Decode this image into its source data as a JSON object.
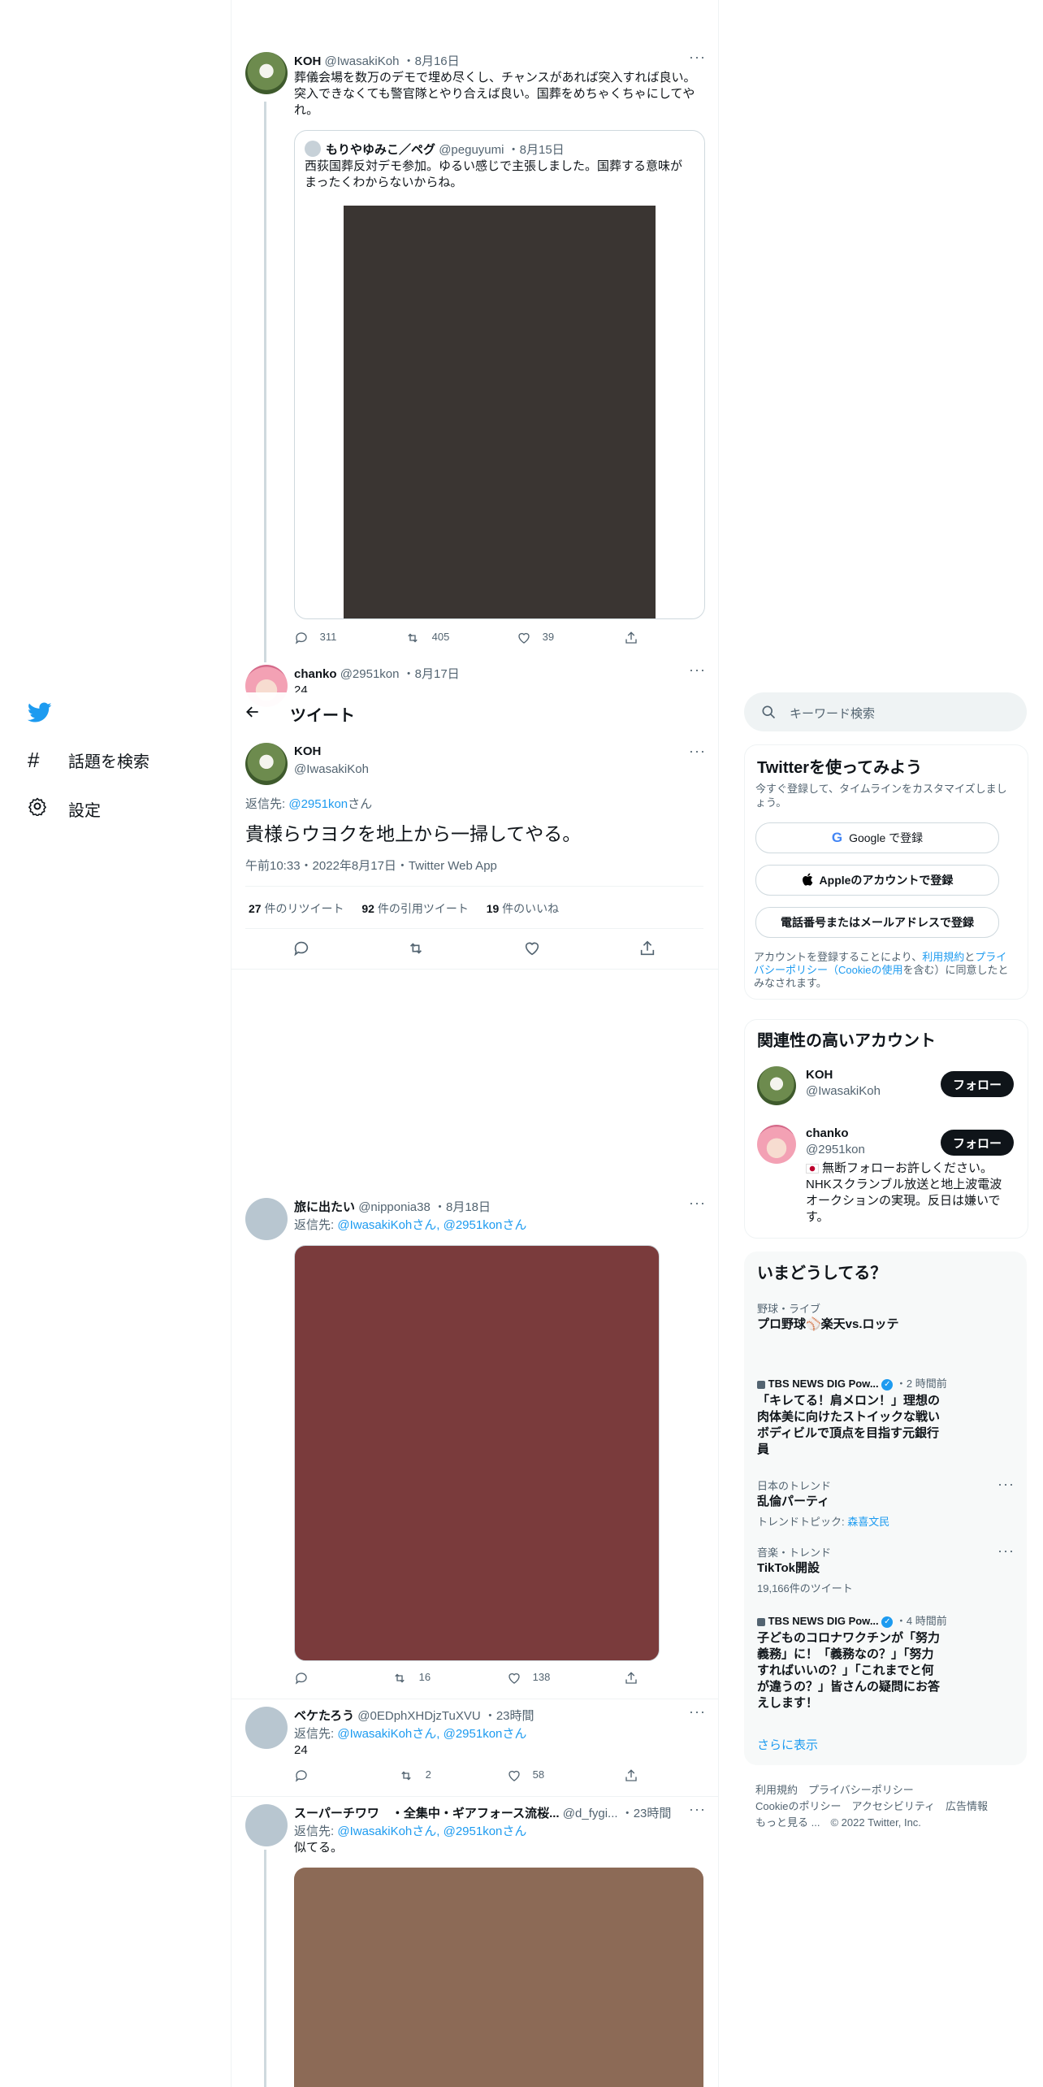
{
  "nav": {
    "explore": "話題を検索",
    "settings": "設定"
  },
  "header": {
    "title": "ツイート"
  },
  "tweet_koh_quote": {
    "name": "KOH",
    "handle": "@IwasakiKoh",
    "date": "・8月16日",
    "text": "葬儀会場を数万のデモで埋め尽くし、チャンスがあれば突入すれば良い。突入できなくても警官隊とやり合えば良い。国葬をめちゃくちゃにしてやれ。",
    "quoted": {
      "name": "もりやゆみこ／ペグ",
      "handle": "@peguyumi",
      "date": "・8月15日",
      "text": "西荻国葬反対デモ参加。ゆるい感じで主張しました。国葬する意味がまったくわからないからね。"
    },
    "replies": "311",
    "retweets": "405",
    "likes": "39"
  },
  "tweet_chanko": {
    "name": "chanko",
    "handle": "@2951kon",
    "date": "・8月17日",
    "text": "24"
  },
  "main_tweet": {
    "name": "KOH",
    "handle": "@IwasakiKoh",
    "reply_prefix": "返信先: ",
    "reply_to": "@2951kon",
    "reply_suffix": "さん",
    "text": "貴様らウヨクを地上から一掃してやる。",
    "meta": "午前10:33・2022年8月17日・Twitter Web App",
    "retweets_count": "27",
    "retweets_label": " 件のリツイート",
    "quotes_count": "92",
    "quotes_label": " 件の引用ツイート",
    "likes_count": "19",
    "likes_label": " 件のいいね"
  },
  "reply1": {
    "name": "旅に出たい",
    "handle": "@nipponia38",
    "date": "・8月18日",
    "reply_prefix": "返信先: ",
    "reply_to": "@IwasakiKohさん, @2951konさん",
    "retweets": "16",
    "likes": "138"
  },
  "reply2": {
    "name": "ベケたろう",
    "handle": "@0EDphXHDjzTuXVU",
    "date": "・23時間",
    "reply_prefix": "返信先: ",
    "reply_to": "@IwasakiKohさん, @2951konさん",
    "text": "24",
    "retweets": "2",
    "likes": "58"
  },
  "reply3": {
    "name": "スーパーチワワ　・全集中・ギアフォース流桜...",
    "handle": "@d_fygi...",
    "date": "・23時間",
    "reply_prefix": "返信先: ",
    "reply_to": "@IwasakiKohさん, @2951konさん",
    "text": "似てる。"
  },
  "search": {
    "placeholder": "キーワード検索"
  },
  "signup": {
    "title": "Twitterを使ってみよう",
    "subtitle": "今すぐ登録して、タイムラインをカスタマイズしましょう。",
    "google": "Google で登録",
    "apple": "Appleのアカウントで登録",
    "phone": "電話番号またはメールアドレスで登録",
    "terms_1": "アカウントを登録することにより、",
    "terms_link1": "利用規約",
    "terms_2": "と",
    "terms_link2": "プライバシーポリシー（Cookieの使用",
    "terms_3": "を含む）に同意したとみなされます。"
  },
  "related": {
    "title": "関連性の高いアカウント",
    "accounts": [
      {
        "name": "KOH",
        "handle": "@IwasakiKoh",
        "button": "フォロー",
        "bio": ""
      },
      {
        "name": "chanko",
        "handle": "@2951kon",
        "button": "フォロー",
        "bio": "無断フォローお許しください。NHKスクランブル放送と地上波電波オークションの実現。反日は嫌いです。"
      }
    ]
  },
  "trends": {
    "title": "いまどうしてる？",
    "items": [
      {
        "meta": "野球・ライブ",
        "title": "プロ野球⚾楽天vs.ロッテ"
      },
      {
        "source": "TBS NEWS DIG Pow...",
        "time": "・2 時間前",
        "title": "「キレてる！肩メロン！」理想の肉体美に向けたストイックな戦いボディビルで頂点を目指す元銀行員"
      },
      {
        "meta": "日本のトレンド",
        "title": "乱倫パーティ",
        "topic_prefix": "トレンドトピック: ",
        "topic": "森喜文民"
      },
      {
        "meta": "音楽・トレンド",
        "title": "TikTok開設",
        "count": "19,166件のツイート"
      },
      {
        "source": "TBS NEWS DIG Pow...",
        "time": "・4 時間前",
        "title": "子どものコロナワクチンが「努力義務」に！「義務なの？」「努力すればいいの？」「これまでと何が違うの？」皆さんの疑問にお答えします！"
      }
    ],
    "more": "さらに表示"
  },
  "footer": {
    "line1": "利用規約　プライバシーポリシー",
    "line2": "Cookieのポリシー　アクセシビリティ　広告情報",
    "line3": "もっと見る ...　© 2022 Twitter, Inc."
  },
  "colors": {
    "accent": "#1d9bf0",
    "text": "#0f1419",
    "muted": "#536471",
    "image_dark": "#3a3532",
    "image_red": "#7a3b3c",
    "image_brown": "#8c6a56"
  }
}
